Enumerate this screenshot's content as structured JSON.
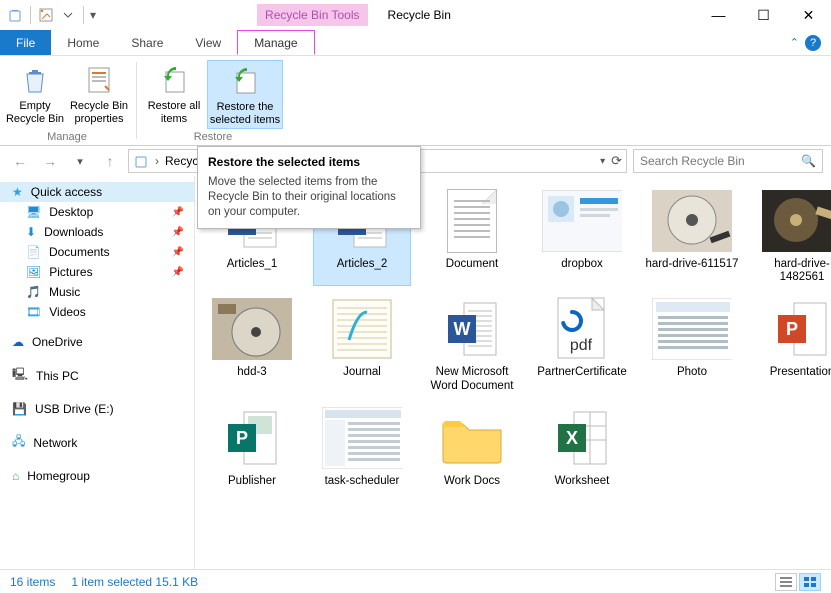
{
  "window": {
    "context_tab": "Recycle Bin Tools",
    "title": "Recycle Bin"
  },
  "ribbon_tabs": {
    "file": "File",
    "home": "Home",
    "share": "Share",
    "view": "View",
    "manage": "Manage"
  },
  "ribbon": {
    "empty": "Empty Recycle Bin",
    "properties": "Recycle Bin properties",
    "restore_all": "Restore all items",
    "restore_selected": "Restore the selected items",
    "group_manage": "Manage",
    "group_restore": "Restore"
  },
  "tooltip": {
    "title": "Restore the selected items",
    "body": "Move the selected items from the Recycle Bin to their original locations on your computer."
  },
  "address": {
    "crumb": "Recycle"
  },
  "search": {
    "placeholder": "Search Recycle Bin"
  },
  "sidebar": {
    "quick_access": "Quick access",
    "desktop": "Desktop",
    "downloads": "Downloads",
    "documents": "Documents",
    "pictures": "Pictures",
    "music": "Music",
    "videos": "Videos",
    "onedrive": "OneDrive",
    "this_pc": "This PC",
    "usb": "USB Drive (E:)",
    "network": "Network",
    "homegroup": "Homegroup"
  },
  "items": [
    {
      "label": "Articles_1",
      "type": "word"
    },
    {
      "label": "Articles_2",
      "type": "word",
      "selected": true
    },
    {
      "label": "Document",
      "type": "text"
    },
    {
      "label": "dropbox",
      "type": "image-dropbox"
    },
    {
      "label": "hard-drive-611517",
      "type": "image-hdd1"
    },
    {
      "label": "hard-drive-1482561",
      "type": "image-hdd2"
    },
    {
      "label": "hdd-3",
      "type": "image-hdd3"
    },
    {
      "label": "Journal",
      "type": "journal"
    },
    {
      "label": "New Microsoft Word Document",
      "type": "word"
    },
    {
      "label": "PartnerCertificate",
      "type": "pdf"
    },
    {
      "label": "Photo",
      "type": "image-screenshot"
    },
    {
      "label": "Presentation",
      "type": "ppt"
    },
    {
      "label": "Publisher",
      "type": "publisher"
    },
    {
      "label": "task-scheduler",
      "type": "image-task"
    },
    {
      "label": "Work Docs",
      "type": "folder"
    },
    {
      "label": "Worksheet",
      "type": "excel"
    }
  ],
  "status": {
    "count": "16 items",
    "selection": "1 item selected",
    "size": "15.1 KB"
  }
}
